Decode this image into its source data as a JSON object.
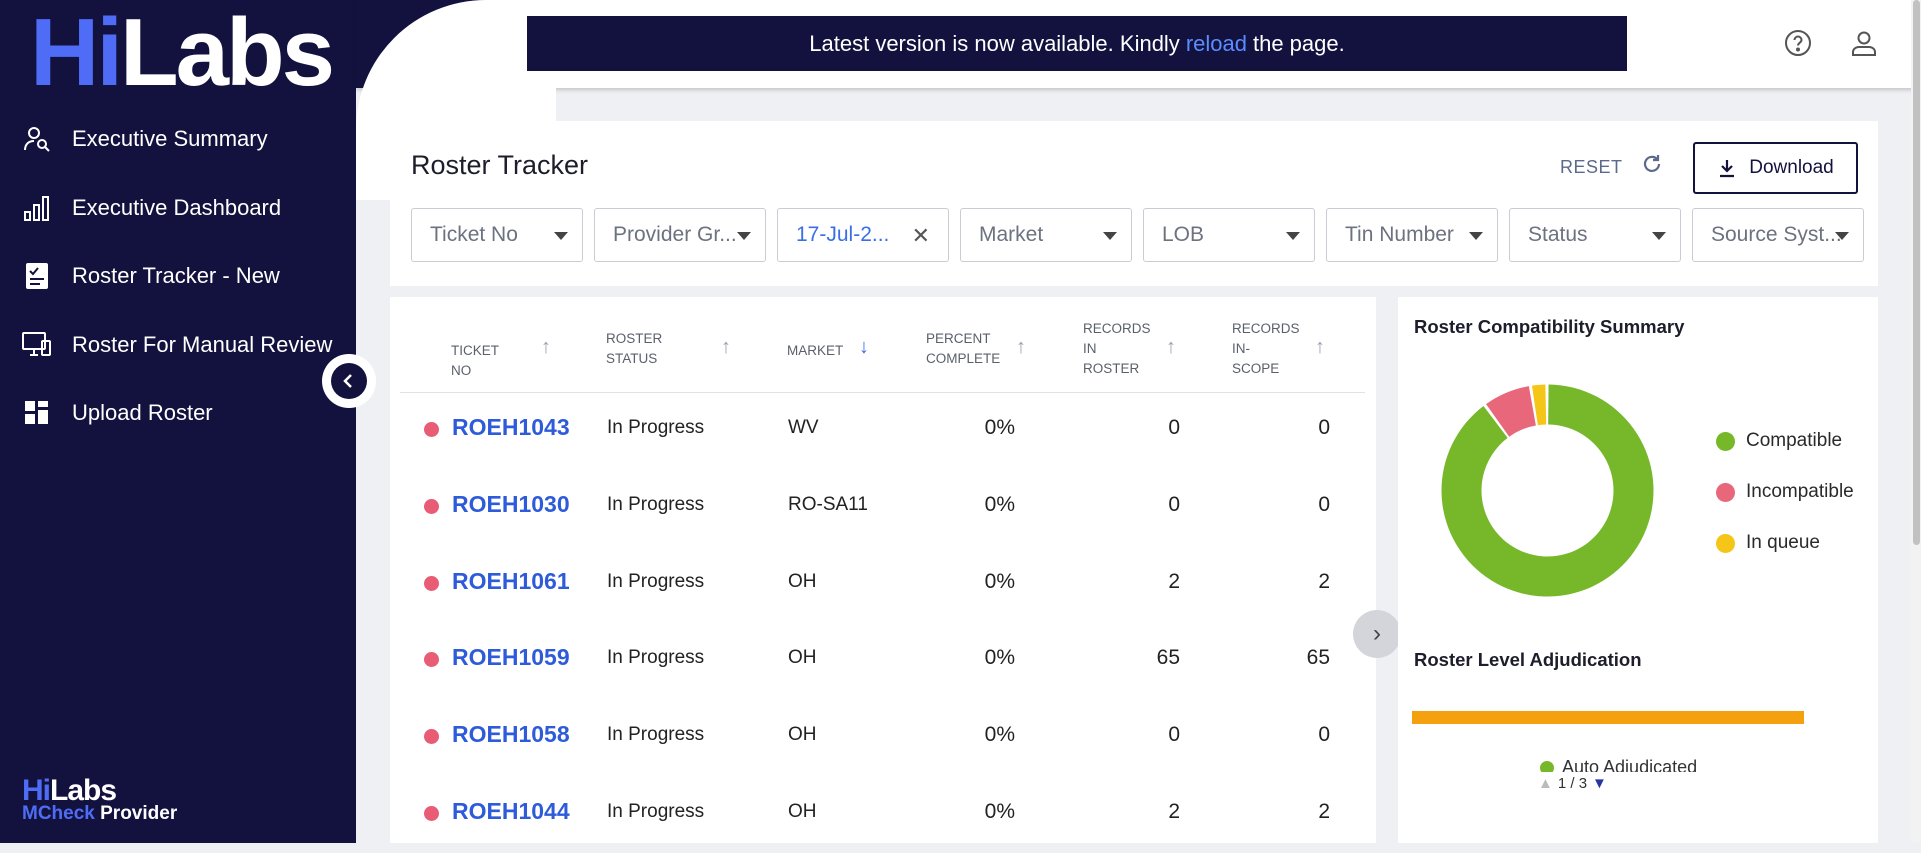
{
  "brand": {
    "hi": "Hi",
    "labs": "Labs",
    "tm": "™",
    "bottom_hi": "Hi",
    "bottom_labs": "Labs",
    "bottom_m": "MCheck",
    "bottom_product": " Provider"
  },
  "sidebar": {
    "items": [
      {
        "label": "Executive Summary",
        "icon": "user-search-icon"
      },
      {
        "label": "Executive Dashboard",
        "icon": "bar-chart-icon"
      },
      {
        "label": "Roster Tracker - New",
        "icon": "checklist-icon"
      },
      {
        "label": "Roster For Manual Review",
        "icon": "monitor-review-icon"
      },
      {
        "label": "Upload Roster",
        "icon": "grid-upload-icon"
      }
    ]
  },
  "banner": {
    "before": "Latest version is now available. Kindly",
    "link": "reload",
    "after": "the page."
  },
  "header": {
    "title": "Roster Tracker",
    "reset": "RESET",
    "download": "Download"
  },
  "filters": [
    {
      "label": "Ticket No"
    },
    {
      "label": "Provider Gr..."
    },
    {
      "label": "17-Jul-2..."
    },
    {
      "label": "Market"
    },
    {
      "label": "LOB"
    },
    {
      "label": "Tin Number"
    },
    {
      "label": "Status"
    },
    {
      "label": "Source Syst..."
    }
  ],
  "table": {
    "columns": {
      "ticket": "TICKET NO",
      "status1": "ROSTER",
      "status2": "STATUS",
      "market": "MARKET",
      "pct1": "PERCENT",
      "pct2": "COMPLETE",
      "rec1": "RECORDS",
      "rec2": "IN",
      "rec3": "ROSTER",
      "scope1": "RECORDS",
      "scope2": "IN-",
      "scope3": "SCOPE"
    },
    "rows": [
      {
        "ticket": "ROEH1043",
        "status": "In Progress",
        "market": "WV",
        "pct": "0%",
        "records": "0",
        "scope": "0"
      },
      {
        "ticket": "ROEH1030",
        "status": "In Progress",
        "market": "RO-SA11",
        "pct": "0%",
        "records": "0",
        "scope": "0"
      },
      {
        "ticket": "ROEH1061",
        "status": "In Progress",
        "market": "OH",
        "pct": "0%",
        "records": "2",
        "scope": "2"
      },
      {
        "ticket": "ROEH1059",
        "status": "In Progress",
        "market": "OH",
        "pct": "0%",
        "records": "65",
        "scope": "65"
      },
      {
        "ticket": "ROEH1058",
        "status": "In Progress",
        "market": "OH",
        "pct": "0%",
        "records": "0",
        "scope": "0"
      },
      {
        "ticket": "ROEH1044",
        "status": "In Progress",
        "market": "OH",
        "pct": "0%",
        "records": "2",
        "scope": "2"
      }
    ]
  },
  "summary": {
    "title": "Roster Compatibility Summary",
    "legend": [
      {
        "label": "Compatible",
        "color": "#76b82a"
      },
      {
        "label": "Incompatible",
        "color": "#e8677a"
      },
      {
        "label": "In queue",
        "color": "#f5c518"
      }
    ],
    "donut_fractions": [
      0.9,
      0.075,
      0.025
    ]
  },
  "adjudication": {
    "title": "Roster Level Adjudication",
    "legend_label": "Auto Adjudicated",
    "pager": "1 / 3",
    "bar_color": "#f5a00f"
  }
}
